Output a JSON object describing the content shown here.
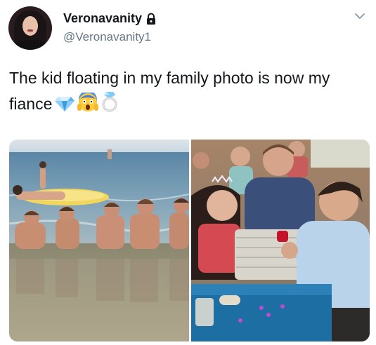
{
  "user": {
    "display_name": "Veronavanity",
    "handle": "@Veronavanity1",
    "protected": true
  },
  "tweet": {
    "text": "The kid floating in my family photo is now my fiance",
    "emojis": [
      "gem-icon",
      "screaming-face-icon",
      "ring-icon"
    ]
  },
  "media": [
    {
      "name": "beach-family-photo"
    },
    {
      "name": "proposal-photo"
    }
  ],
  "icons": {
    "lock": "lock-icon",
    "menu": "chevron-down-icon"
  },
  "colors": {
    "text": "#14171a",
    "secondary": "#657786"
  }
}
